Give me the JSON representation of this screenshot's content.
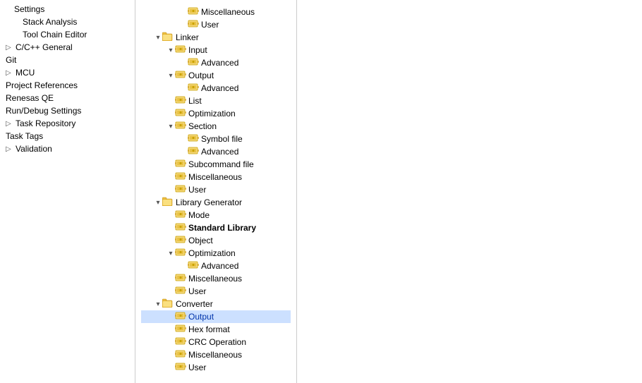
{
  "sidebar": {
    "items": [
      {
        "label": "Settings",
        "indent": 0,
        "selected": false,
        "expandable": false
      },
      {
        "label": "Stack Analysis",
        "indent": 1,
        "selected": false,
        "expandable": false
      },
      {
        "label": "Tool Chain Editor",
        "indent": 1,
        "selected": false,
        "expandable": false
      },
      {
        "label": "C/C++ General",
        "indent": 0,
        "selected": false,
        "expandable": true
      },
      {
        "label": "Git",
        "indent": 0,
        "selected": false,
        "expandable": false
      },
      {
        "label": "MCU",
        "indent": 0,
        "selected": false,
        "expandable": true
      },
      {
        "label": "Project References",
        "indent": 0,
        "selected": false,
        "expandable": false
      },
      {
        "label": "Renesas QE",
        "indent": 0,
        "selected": false,
        "expandable": false
      },
      {
        "label": "Run/Debug Settings",
        "indent": 0,
        "selected": false,
        "expandable": false
      },
      {
        "label": "Task Repository",
        "indent": 0,
        "selected": false,
        "expandable": true
      },
      {
        "label": "Task Tags",
        "indent": 0,
        "selected": false,
        "expandable": false
      },
      {
        "label": "Validation",
        "indent": 0,
        "selected": false,
        "expandable": true
      }
    ]
  },
  "tree": {
    "nodes": [
      {
        "id": "miscellaneous-top",
        "label": "Miscellaneous",
        "depth": 3,
        "hasToggle": false,
        "expanded": false,
        "icon": "gear"
      },
      {
        "id": "user-top",
        "label": "User",
        "depth": 3,
        "hasToggle": false,
        "expanded": false,
        "icon": "gear"
      },
      {
        "id": "linker",
        "label": "Linker",
        "depth": 1,
        "hasToggle": true,
        "expanded": true,
        "icon": "folder"
      },
      {
        "id": "input",
        "label": "Input",
        "depth": 2,
        "hasToggle": true,
        "expanded": true,
        "icon": "gear"
      },
      {
        "id": "input-advanced",
        "label": "Advanced",
        "depth": 3,
        "hasToggle": false,
        "expanded": false,
        "icon": "gear"
      },
      {
        "id": "output",
        "label": "Output",
        "depth": 2,
        "hasToggle": true,
        "expanded": true,
        "icon": "gear"
      },
      {
        "id": "output-advanced",
        "label": "Advanced",
        "depth": 3,
        "hasToggle": false,
        "expanded": false,
        "icon": "gear"
      },
      {
        "id": "list",
        "label": "List",
        "depth": 2,
        "hasToggle": false,
        "expanded": false,
        "icon": "gear"
      },
      {
        "id": "optimization",
        "label": "Optimization",
        "depth": 2,
        "hasToggle": false,
        "expanded": false,
        "icon": "gear"
      },
      {
        "id": "section",
        "label": "Section",
        "depth": 2,
        "hasToggle": true,
        "expanded": true,
        "icon": "gear"
      },
      {
        "id": "symbol-file",
        "label": "Symbol file",
        "depth": 3,
        "hasToggle": false,
        "expanded": false,
        "icon": "gear"
      },
      {
        "id": "section-advanced",
        "label": "Advanced",
        "depth": 3,
        "hasToggle": false,
        "expanded": false,
        "icon": "gear"
      },
      {
        "id": "subcommand-file",
        "label": "Subcommand file",
        "depth": 2,
        "hasToggle": false,
        "expanded": false,
        "icon": "gear"
      },
      {
        "id": "linker-misc",
        "label": "Miscellaneous",
        "depth": 2,
        "hasToggle": false,
        "expanded": false,
        "icon": "gear"
      },
      {
        "id": "linker-user",
        "label": "User",
        "depth": 2,
        "hasToggle": false,
        "expanded": false,
        "icon": "gear"
      },
      {
        "id": "library-generator",
        "label": "Library Generator",
        "depth": 1,
        "hasToggle": true,
        "expanded": true,
        "icon": "folder"
      },
      {
        "id": "mode",
        "label": "Mode",
        "depth": 2,
        "hasToggle": false,
        "expanded": false,
        "icon": "gear"
      },
      {
        "id": "standard-library",
        "label": "Standard Library",
        "depth": 2,
        "hasToggle": false,
        "expanded": false,
        "icon": "gear",
        "bold": true
      },
      {
        "id": "object",
        "label": "Object",
        "depth": 2,
        "hasToggle": false,
        "expanded": false,
        "icon": "gear"
      },
      {
        "id": "lib-optimization",
        "label": "Optimization",
        "depth": 2,
        "hasToggle": true,
        "expanded": true,
        "icon": "gear"
      },
      {
        "id": "lib-opt-advanced",
        "label": "Advanced",
        "depth": 3,
        "hasToggle": false,
        "expanded": false,
        "icon": "gear"
      },
      {
        "id": "lib-misc",
        "label": "Miscellaneous",
        "depth": 2,
        "hasToggle": false,
        "expanded": false,
        "icon": "gear"
      },
      {
        "id": "lib-user",
        "label": "User",
        "depth": 2,
        "hasToggle": false,
        "expanded": false,
        "icon": "gear"
      },
      {
        "id": "converter",
        "label": "Converter",
        "depth": 1,
        "hasToggle": true,
        "expanded": true,
        "icon": "folder"
      },
      {
        "id": "conv-output",
        "label": "Output",
        "depth": 2,
        "hasToggle": false,
        "expanded": false,
        "icon": "gear",
        "selected": true
      },
      {
        "id": "hex-format",
        "label": "Hex format",
        "depth": 2,
        "hasToggle": false,
        "expanded": false,
        "icon": "gear"
      },
      {
        "id": "crc-operation",
        "label": "CRC Operation",
        "depth": 2,
        "hasToggle": false,
        "expanded": false,
        "icon": "gear"
      },
      {
        "id": "conv-misc",
        "label": "Miscellaneous",
        "depth": 2,
        "hasToggle": false,
        "expanded": false,
        "icon": "gear"
      },
      {
        "id": "conv-user",
        "label": "User",
        "depth": 2,
        "hasToggle": false,
        "expanded": false,
        "icon": "gear"
      }
    ]
  }
}
